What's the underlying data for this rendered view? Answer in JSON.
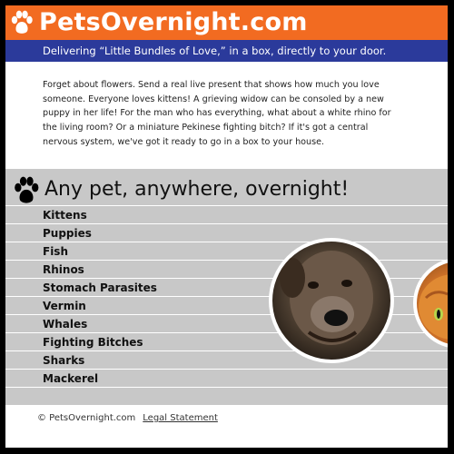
{
  "header": {
    "title": "PetsOvernight.com",
    "tagline": "Delivering “Little Bundles of Love,” in a box, directly to your door."
  },
  "intro": {
    "text": "Forget about flowers. Send a real live present that shows how much you love someone. Everyone loves kittens! A grieving widow can be consoled by a new puppy in her life! For the man who has everything, what about a white rhino for the living room? Or a miniature Pekinese fighting bitch? If it's got a central nervous system, we've got it ready to go in a box to your house."
  },
  "list_section": {
    "heading": "Any pet, anywhere, overnight!",
    "items": [
      "Kittens",
      "Puppies",
      "Fish",
      "Rhinos",
      "Stomach Parasites",
      "Vermin",
      "Whales",
      "Fighting Bitches",
      "Sharks",
      "Mackerel"
    ]
  },
  "footer": {
    "copyright": "© PetsOvernight.com",
    "legal_link": "Legal Statement"
  },
  "colors": {
    "header_orange": "#f26b21",
    "tagline_blue": "#2b3a9b",
    "list_gray": "#c8c8c8"
  },
  "icons": {
    "header_icon": "paw-print-icon",
    "section_icon": "paw-print-icon"
  }
}
